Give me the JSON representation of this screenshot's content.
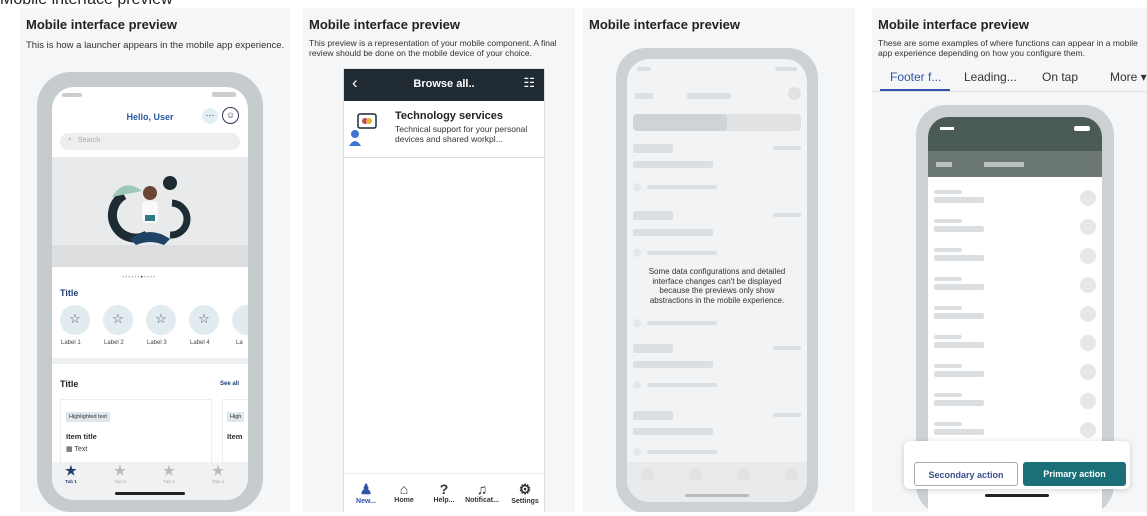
{
  "top_caption": "Mobile interface preview",
  "panels": [
    {
      "title": "Mobile interface preview",
      "description": "This is how a launcher appears in the mobile app experience.",
      "greeting": "Hello, User",
      "search_placeholder": "Search",
      "section1_title": "Title",
      "labels": [
        "Label 1",
        "Label 2",
        "Label 3",
        "Label 4",
        "La"
      ],
      "section2_title": "Title",
      "see_all": "See all",
      "card1": {
        "tag": "Highlighted text",
        "title": "Item title",
        "meta": "Text"
      },
      "card2": {
        "tag": "High",
        "title": "Item"
      },
      "tabs": [
        "Tab 1",
        "Tab 2",
        "Tab 3",
        "Tab 4"
      ]
    },
    {
      "title": "Mobile interface preview",
      "description": "This preview is a representation of your mobile component. A final review should be done on the mobile device of your choice.",
      "header": "Browse all..",
      "item_title": "Technology services",
      "item_desc": "Technical support for your personal devices and shared workpl...",
      "nav": [
        "New...",
        "Home",
        "Help...",
        "Notificat...",
        "Settings"
      ]
    },
    {
      "title": "Mobile interface preview",
      "notice": "Some data configurations and detailed interface changes can't be displayed because the previews only show abstractions in the mobile experience."
    },
    {
      "title": "Mobile interface preview",
      "description": "These are some examples of where functions can appear in a mobile app experience depending on how you configure them.",
      "tabs": [
        "Footer f...",
        "Leading...",
        "On tap",
        "More ▾"
      ],
      "secondary_action": "Secondary action",
      "primary_action": "Primary action"
    }
  ],
  "colors": {
    "brand_dark": "#1f2a33",
    "primary": "#1a6f78",
    "accent_blue": "#3353a8",
    "panel_bg": "#f5f6f7"
  }
}
